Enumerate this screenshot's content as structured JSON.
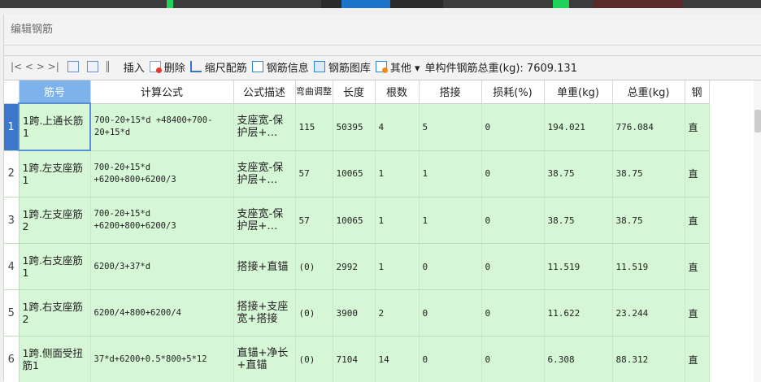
{
  "panel_title": "编辑钢筋",
  "toolbar": {
    "nav": "|<  <  >  >|",
    "insert_label": "插入",
    "delete_label": "删除",
    "scale_label": "缩尺配筋",
    "info_label": "钢筋信息",
    "library_label": "钢筋图库",
    "other_label": "其他 ▾",
    "total_weight": "单构件钢筋总重(kg): 7609.131"
  },
  "columns": [
    "筋号",
    "计算公式",
    "公式描述",
    "弯曲调整",
    "长度",
    "根数",
    "搭接",
    "损耗(%)",
    "单重(kg)",
    "总重(kg)",
    "钢"
  ],
  "rows": [
    {
      "n": "1",
      "name": "1跨.上通长筋1",
      "formula": "700-20+15*d +48400+700-20+15*d",
      "desc": "支座宽-保护层+…",
      "bend": "115",
      "len": "50395",
      "count": "4",
      "lap": "5",
      "loss": "0",
      "unit_w": "194.021",
      "total_w": "776.084",
      "type": "直"
    },
    {
      "n": "2",
      "name": "1跨.左支座筋1",
      "formula": "700-20+15*d +6200+800+6200/3",
      "desc": "支座宽-保护层+…",
      "bend": "57",
      "len": "10065",
      "count": "1",
      "lap": "1",
      "loss": "0",
      "unit_w": "38.75",
      "total_w": "38.75",
      "type": "直"
    },
    {
      "n": "3",
      "name": "1跨.左支座筋2",
      "formula": "700-20+15*d +6200+800+6200/3",
      "desc": "支座宽-保护层+…",
      "bend": "57",
      "len": "10065",
      "count": "1",
      "lap": "1",
      "loss": "0",
      "unit_w": "38.75",
      "total_w": "38.75",
      "type": "直"
    },
    {
      "n": "4",
      "name": "1跨.右支座筋1",
      "formula": "6200/3+37*d",
      "desc": "搭接+直锚",
      "bend": "(0)",
      "len": "2992",
      "count": "1",
      "lap": "0",
      "loss": "0",
      "unit_w": "11.519",
      "total_w": "11.519",
      "type": "直"
    },
    {
      "n": "5",
      "name": "1跨.右支座筋2",
      "formula": "6200/4+800+6200/4",
      "desc": "搭接+支座宽+搭接",
      "bend": "(0)",
      "len": "3900",
      "count": "2",
      "lap": "0",
      "loss": "0",
      "unit_w": "11.622",
      "total_w": "23.244",
      "type": "直"
    },
    {
      "n": "6",
      "name": "1跨.侧面受扭筋1",
      "formula": "37*d+6200+0.5*800+5*12",
      "desc": "直锚+净长+直锚",
      "bend": "(0)",
      "len": "7104",
      "count": "14",
      "lap": "0",
      "loss": "0",
      "unit_w": "6.308",
      "total_w": "88.312",
      "type": "直"
    }
  ]
}
